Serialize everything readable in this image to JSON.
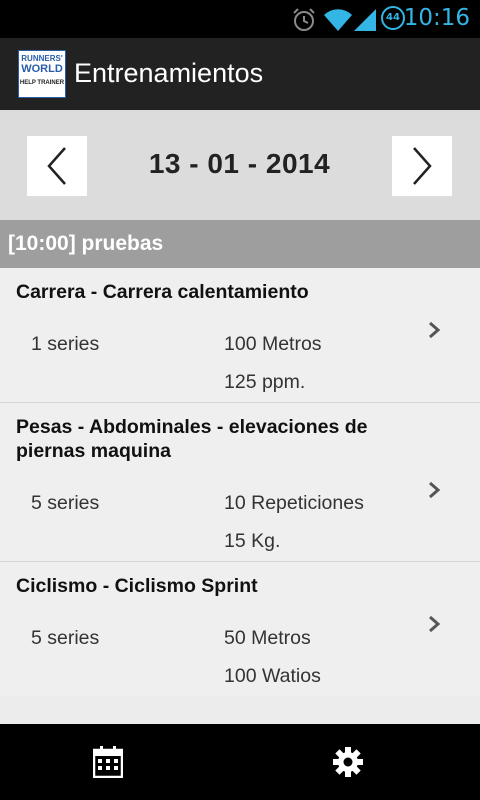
{
  "status_bar": {
    "time": "10:16",
    "battery_level": "44",
    "icons": [
      "alarm-icon",
      "wifi-icon",
      "signal-icon",
      "battery-icon"
    ]
  },
  "action_bar": {
    "title": "Entrenamientos",
    "logo_line1": "RUNNERS'",
    "logo_line2": "WORLD",
    "logo_line3": "HELP TRAINER"
  },
  "date_nav": {
    "date": "13 - 01 - 2014",
    "prev_icon": "chevron-left-icon",
    "next_icon": "chevron-right-icon"
  },
  "session": {
    "header": "[10:00] pruebas"
  },
  "exercises": [
    {
      "title": "Carrera - Carrera calentamiento",
      "series": "1 series",
      "value1": "100 Metros",
      "value2": "125 ppm."
    },
    {
      "title": "Pesas - Abdominales - elevaciones de piernas maquina",
      "series": "5 series",
      "value1": "10 Repeticiones",
      "value2": "15 Kg."
    },
    {
      "title": "Ciclismo - Ciclismo Sprint",
      "series": "5 series",
      "value1": "50 Metros",
      "value2": "100 Watios"
    }
  ],
  "bottom_bar": {
    "icons": [
      "calendar-icon",
      "gear-icon"
    ]
  },
  "colors": {
    "status_time": "#33b5e5",
    "action_bar": "#222222",
    "session_header": "#9e9e9e",
    "list_background": "#efefef"
  }
}
